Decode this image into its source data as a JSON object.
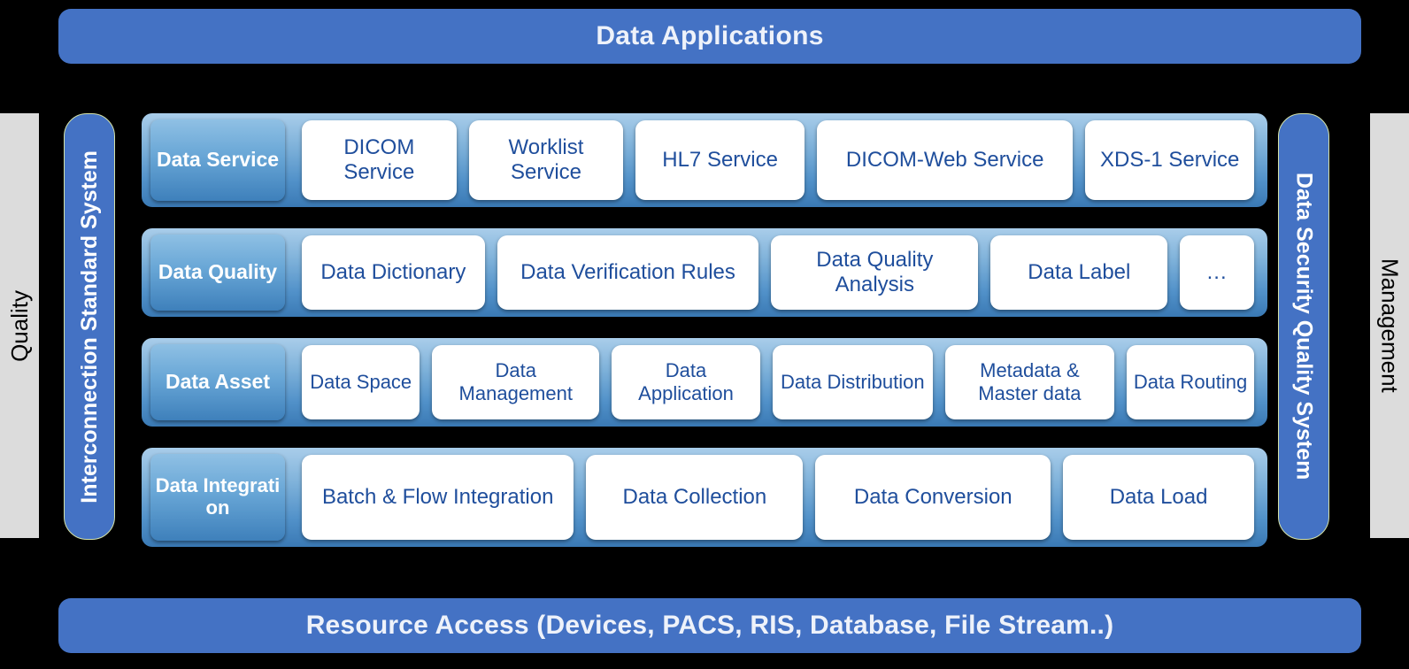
{
  "top_band": {
    "label": "Data Applications"
  },
  "bottom_band": {
    "label": "Resource Access (Devices, PACS, RIS, Database, File Stream..)"
  },
  "left_outer": {
    "label": "Quality"
  },
  "right_outer": {
    "label": "Management"
  },
  "left_pillar": {
    "label": "Interconnection Standard System"
  },
  "right_pillar": {
    "label": "Data Security Quality System"
  },
  "colors": {
    "band_blue": "#4472c4",
    "row_gradient_top": "#a9cdea",
    "row_gradient_bottom": "#3a79b4",
    "label_pill_top": "#8fc0e4",
    "label_pill_bottom": "#3e80bb",
    "cell_background": "#ffffff",
    "cell_text": "#1f4e9c",
    "side_gray": "#dcdcdc",
    "pillar_border": "#d5e3a8",
    "background": "#000000"
  },
  "rows": [
    {
      "label": "Data Service",
      "cells": [
        {
          "text": "DICOM Service",
          "flex": 1.02
        },
        {
          "text": "Worklist Service",
          "flex": 1.02
        },
        {
          "text": "HL7 Service",
          "flex": 1.12
        },
        {
          "text": "DICOM-Web Service",
          "flex": 1.74
        },
        {
          "text": "XDS-1 Service",
          "flex": 1.12
        }
      ]
    },
    {
      "label": "Data Quality",
      "cells": [
        {
          "text": "Data Dictionary",
          "flex": 1.14
        },
        {
          "text": "Data Verification Rules",
          "flex": 1.66
        },
        {
          "text": "Data Quality Analysis",
          "flex": 1.3
        },
        {
          "text": "Data Label",
          "flex": 1.1
        },
        {
          "text": "...",
          "flex": 0.42
        }
      ]
    },
    {
      "label": "Data Asset",
      "cells": [
        {
          "text": "Data Space",
          "flex": 0.92
        },
        {
          "text": "Data Management",
          "flex": 1.34
        },
        {
          "text": "Data Application",
          "flex": 1.18
        },
        {
          "text": "Data Distribution",
          "flex": 1.28
        },
        {
          "text": "Metadata & Master data",
          "flex": 1.36
        },
        {
          "text": "Data Routing",
          "flex": 1.0
        }
      ]
    },
    {
      "label": "Data Integration",
      "cells": [
        {
          "text": "Batch & Flow Integration",
          "flex": 1.42
        },
        {
          "text": "Data Collection",
          "flex": 1.12
        },
        {
          "text": "Data Conversion",
          "flex": 1.22
        },
        {
          "text": "Data Load",
          "flex": 0.98
        }
      ]
    }
  ]
}
